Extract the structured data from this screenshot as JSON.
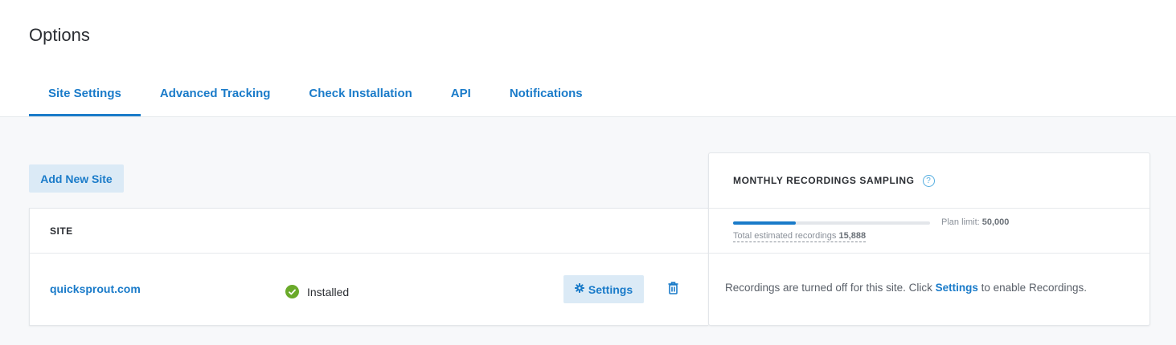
{
  "page": {
    "title": "Options"
  },
  "tabs": [
    {
      "label": "Site Settings",
      "active": true
    },
    {
      "label": "Advanced Tracking",
      "active": false
    },
    {
      "label": "Check Installation",
      "active": false
    },
    {
      "label": "API",
      "active": false
    },
    {
      "label": "Notifications",
      "active": false
    }
  ],
  "sites": {
    "add_button": "Add New Site",
    "column_header": "SITE",
    "rows": [
      {
        "domain": "quicksprout.com",
        "status": "Installed",
        "settings_label": "Settings"
      }
    ]
  },
  "sampling": {
    "title": "MONTHLY RECORDINGS SAMPLING",
    "help_icon": "?",
    "plan_limit_label": "Plan limit:",
    "plan_limit_value": "50,000",
    "total_label": "Total estimated recordings",
    "total_value": "15,888",
    "progress_fraction": 0.3178,
    "message_before": "Recordings are turned off for this site. Click ",
    "message_link": "Settings",
    "message_after": " to enable Recordings."
  },
  "colors": {
    "accent": "#1a7bc9",
    "accent_light": "#dbeaf6",
    "success": "#6aaa2a",
    "background": "#f7f8fa"
  }
}
